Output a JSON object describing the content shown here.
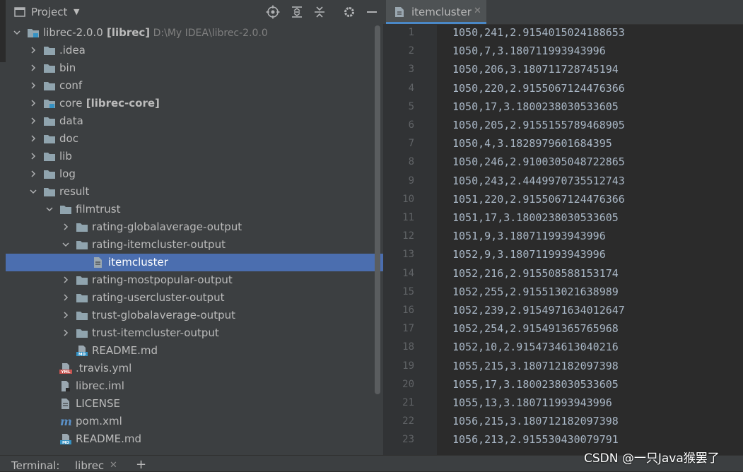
{
  "project_panel": {
    "title": "Project",
    "icons": [
      "locate-icon",
      "expand-all-icon",
      "collapse-all-icon",
      "gear-icon",
      "minimize-icon"
    ]
  },
  "tree": [
    {
      "depth": 0,
      "expanded": true,
      "type": "module-folder",
      "label": "librec-2.0.0",
      "bold": "[librec]",
      "path": "D:\\My IDEA\\librec-2.0.0"
    },
    {
      "depth": 1,
      "expanded": false,
      "type": "folder",
      "label": ".idea"
    },
    {
      "depth": 1,
      "expanded": false,
      "type": "folder",
      "label": "bin"
    },
    {
      "depth": 1,
      "expanded": false,
      "type": "folder",
      "label": "conf"
    },
    {
      "depth": 1,
      "expanded": false,
      "type": "module-folder",
      "label": "core",
      "bold": "[librec-core]"
    },
    {
      "depth": 1,
      "expanded": false,
      "type": "folder",
      "label": "data"
    },
    {
      "depth": 1,
      "expanded": false,
      "type": "folder",
      "label": "doc"
    },
    {
      "depth": 1,
      "expanded": false,
      "type": "folder",
      "label": "lib"
    },
    {
      "depth": 1,
      "expanded": false,
      "type": "folder",
      "label": "log"
    },
    {
      "depth": 1,
      "expanded": true,
      "type": "folder",
      "label": "result"
    },
    {
      "depth": 2,
      "expanded": true,
      "type": "folder",
      "label": "filmtrust"
    },
    {
      "depth": 3,
      "expanded": false,
      "type": "folder",
      "label": "rating-globalaverage-output"
    },
    {
      "depth": 3,
      "expanded": true,
      "type": "folder",
      "label": "rating-itemcluster-output"
    },
    {
      "depth": 4,
      "type": "file",
      "label": "itemcluster",
      "selected": true
    },
    {
      "depth": 3,
      "expanded": false,
      "type": "folder",
      "label": "rating-mostpopular-output"
    },
    {
      "depth": 3,
      "expanded": false,
      "type": "folder",
      "label": "rating-usercluster-output"
    },
    {
      "depth": 3,
      "expanded": false,
      "type": "folder",
      "label": "trust-globalaverage-output"
    },
    {
      "depth": 3,
      "expanded": false,
      "type": "folder",
      "label": "trust-itemcluster-output"
    },
    {
      "depth": 3,
      "type": "md",
      "label": "README.md"
    },
    {
      "depth": 2,
      "type": "yml",
      "label": ".travis.yml"
    },
    {
      "depth": 2,
      "type": "iml",
      "label": "librec.iml"
    },
    {
      "depth": 2,
      "type": "file",
      "label": "LICENSE"
    },
    {
      "depth": 2,
      "type": "maven",
      "label": "pom.xml"
    },
    {
      "depth": 2,
      "type": "md",
      "label": "README.md"
    }
  ],
  "editor": {
    "tab_label": "itemcluster",
    "lines": [
      "1050,241,2.9154015024188653",
      "1050,7,3.180711993943996",
      "1050,206,3.180711728745194",
      "1050,220,2.9155067124476366",
      "1050,17,3.1800238030533605",
      "1050,205,2.9155155789468905",
      "1050,4,3.1828979601684395",
      "1050,246,2.9100305048722865",
      "1050,243,2.4449970735512743",
      "1051,220,2.9155067124476366",
      "1051,17,3.1800238030533605",
      "1051,9,3.180711993943996",
      "1052,9,3.180711993943996",
      "1052,216,2.915508588153174",
      "1052,255,2.915513021638989",
      "1052,239,2.9154971634012647",
      "1052,254,2.915491365765968",
      "1052,10,2.9154734613040216",
      "1055,215,3.180712182097398",
      "1055,17,3.1800238030533605",
      "1055,13,3.180711993943996",
      "1056,215,3.180712182097398",
      "1056,213,2.915530430079791"
    ]
  },
  "bottom_bar": {
    "terminal_label": "Terminal:",
    "terminal_tab": "librec"
  },
  "watermark": "CSDN @一只Java猴罢了",
  "colors": {
    "panel_bg": "#3c3f41",
    "editor_bg": "#2b2b2b",
    "selection": "#4b6eaf",
    "folder": "#90a4ae",
    "tab_underline": "#4a88c7"
  }
}
